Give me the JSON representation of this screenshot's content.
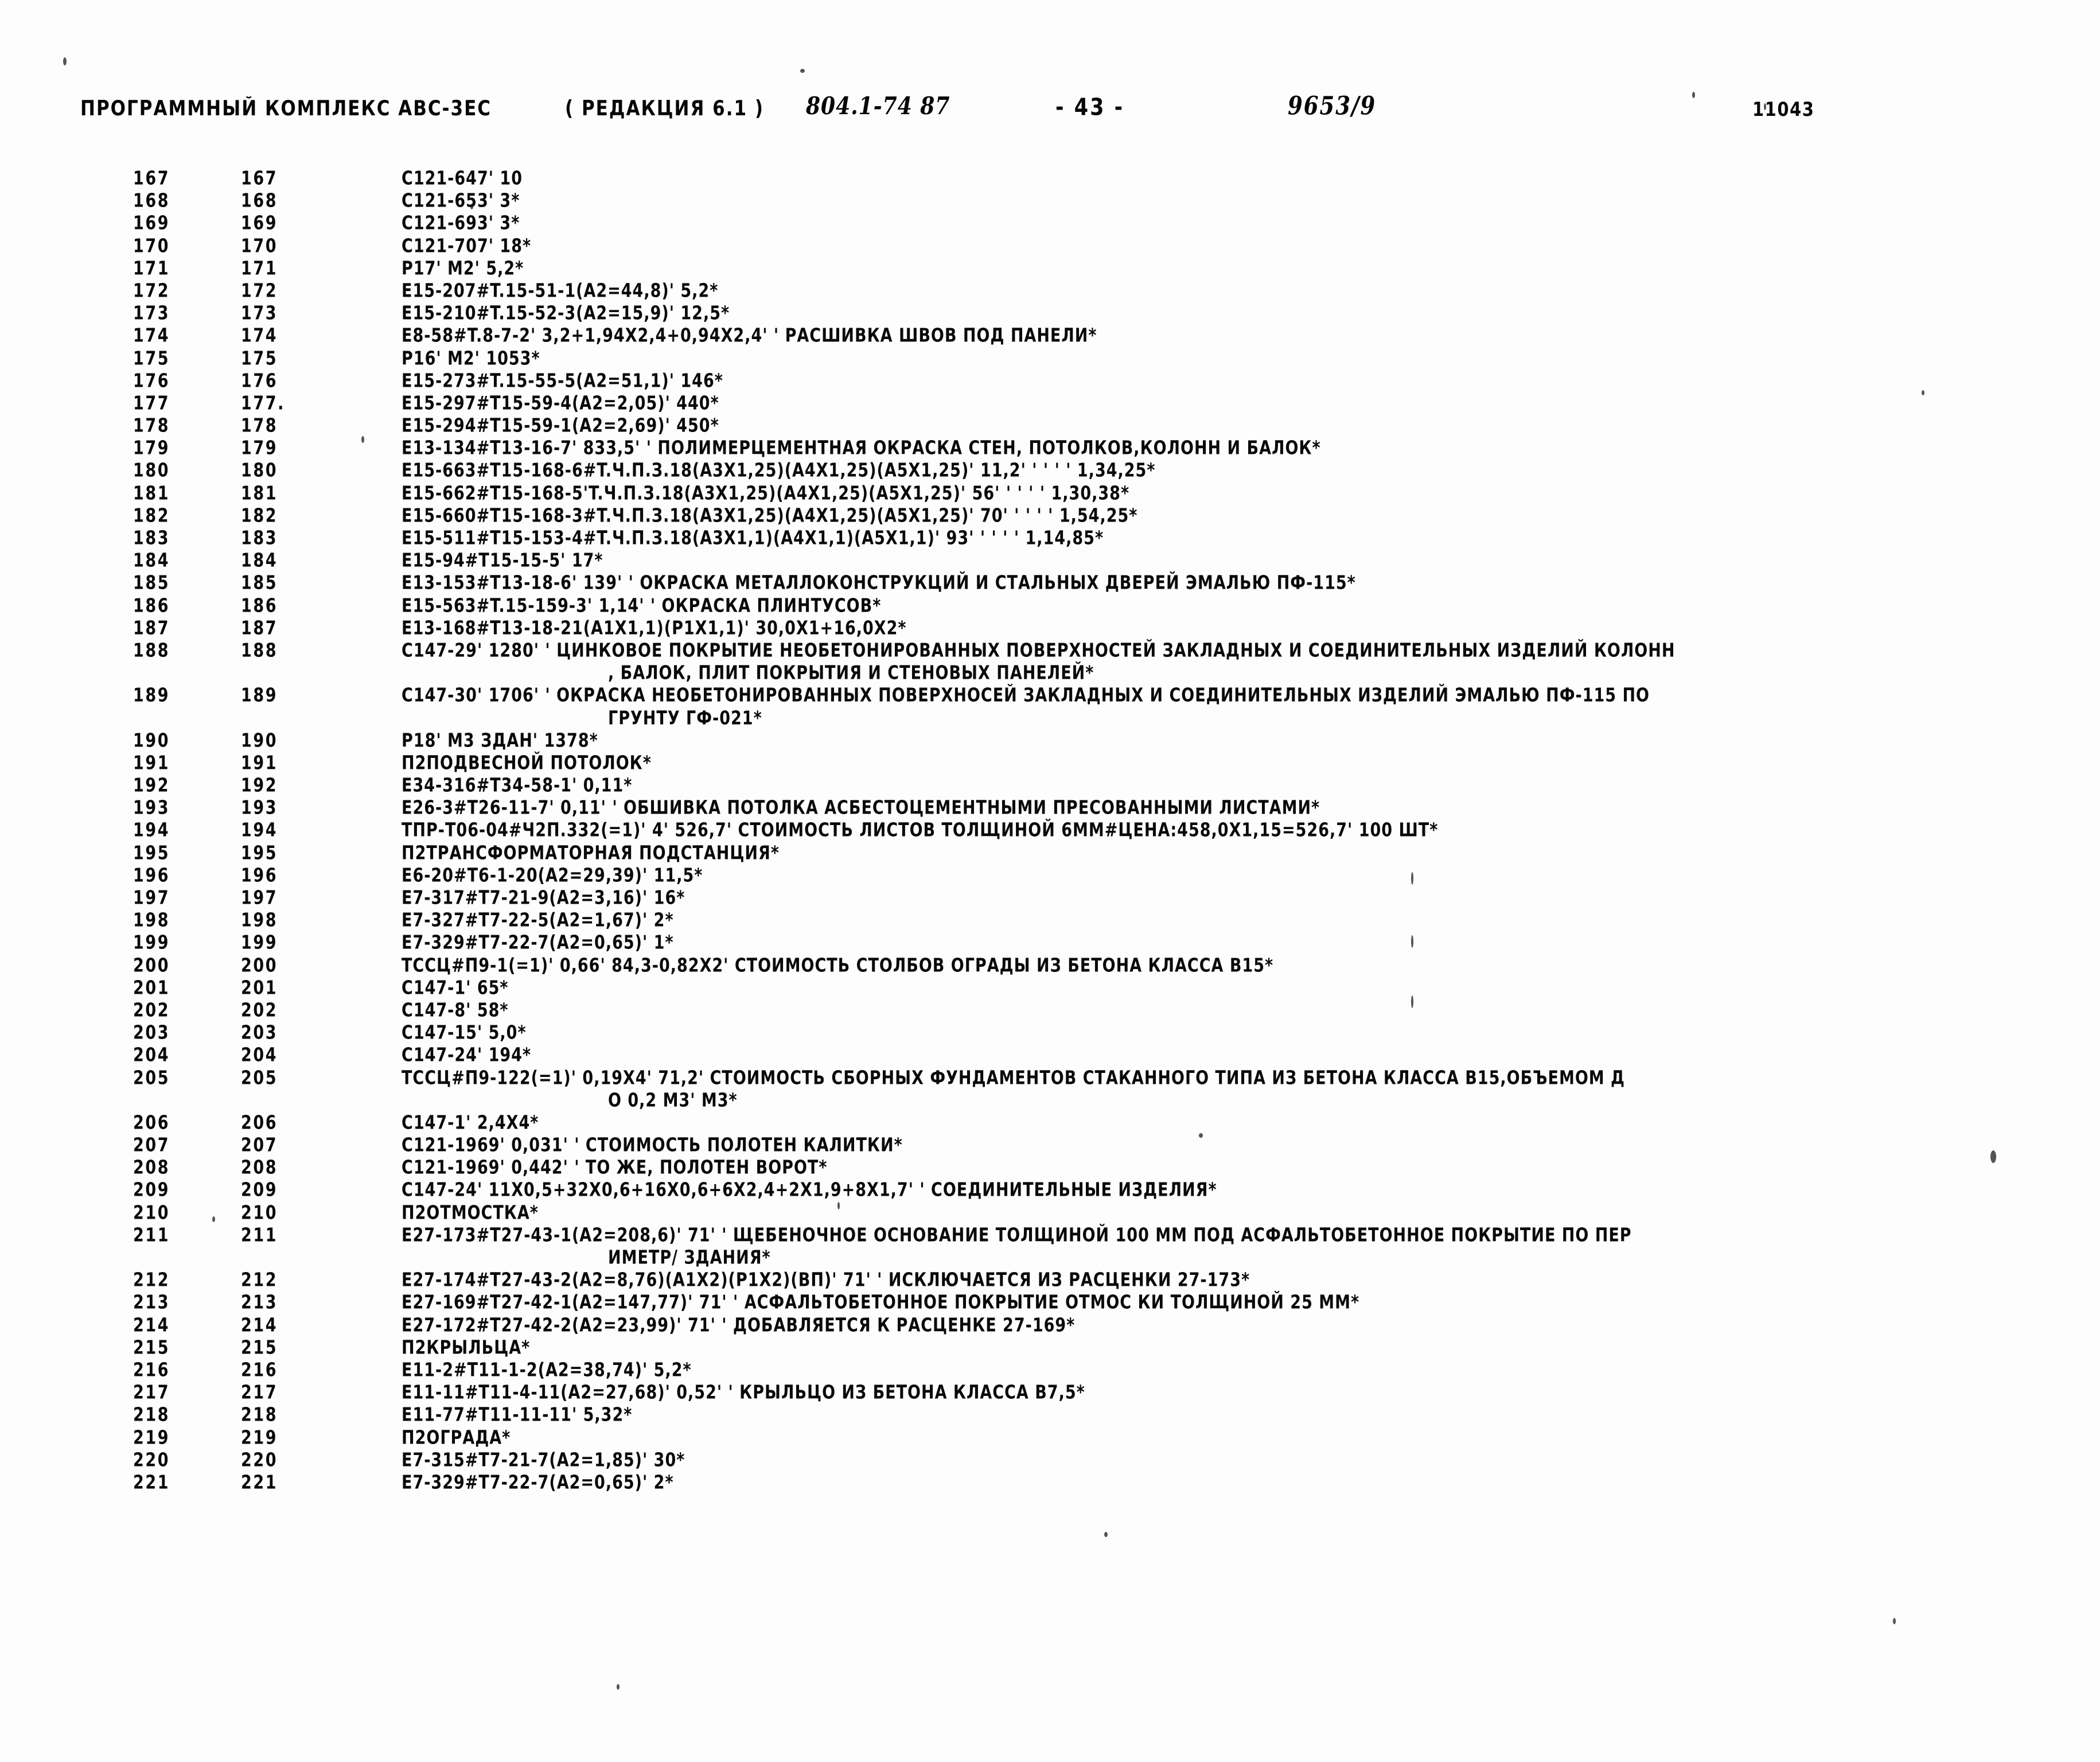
{
  "header": {
    "title": "ПРОГРАММНЫЙ КОМПЛЕКС АВС-3ЕС",
    "edition": "( РЕДАКЦИЯ 6.1 )",
    "code": "804.1-74 87",
    "page": "- 43 -",
    "order": "9653/9",
    "doc_number": "11043"
  },
  "listing": {
    "rows": [
      {
        "n1": "167",
        "n2": "167",
        "code": "C121-647' 10"
      },
      {
        "n1": "168",
        "n2": "168",
        "code": "C121-653' 3*"
      },
      {
        "n1": "169",
        "n2": "169",
        "code": "C121-693' 3*"
      },
      {
        "n1": "170",
        "n2": "170",
        "code": "C121-707' 18*"
      },
      {
        "n1": "171",
        "n2": "171",
        "code": "P17' M2' 5,2*"
      },
      {
        "n1": "172",
        "n2": "172",
        "code": "E15-207#T.15-51-1(A2=44,8)' 5,2*"
      },
      {
        "n1": "173",
        "n2": "173",
        "code": "E15-210#T.15-52-3(A2=15,9)' 12,5*"
      },
      {
        "n1": "174",
        "n2": "174",
        "code": "E8-58#T.8-7-2' 3,2+1,94X2,4+0,94X2,4' ' РАСШИВКА ШВОВ ПОД ПАНЕЛИ*"
      },
      {
        "n1": "175",
        "n2": "175",
        "code": "P16' M2' 1053*"
      },
      {
        "n1": "176",
        "n2": "176",
        "code": "E15-273#T.15-55-5(A2=51,1)' 146*"
      },
      {
        "n1": "177",
        "n2": "177.",
        "code": "E15-297#T15-59-4(A2=2,05)' 440*"
      },
      {
        "n1": "178",
        "n2": "178",
        "code": "E15-294#T15-59-1(A2=2,69)' 450*"
      },
      {
        "n1": "179",
        "n2": "179",
        "code": "E13-134#T13-16-7' 833,5' ' ПОЛИМЕРЦЕМЕНТНАЯ ОКРАСКА СТЕН, ПОТОЛКОВ,КОЛОНН И БАЛОК*"
      },
      {
        "n1": "180",
        "n2": "180",
        "code": "E15-663#T15-168-6#T.Ч.П.З.18(A3X1,25)(A4X1,25)(A5X1,25)' 11,2' ' ' ' ' 1,34,25*"
      },
      {
        "n1": "181",
        "n2": "181",
        "code": "E15-662#T15-168-5'T.Ч.П.З.18(A3X1,25)(A4X1,25)(A5X1,25)' 56' ' ' ' ' 1,30,38*"
      },
      {
        "n1": "182",
        "n2": "182",
        "code": "E15-660#T15-168-3#T.Ч.П.З.18(A3X1,25)(A4X1,25)(A5X1,25)' 70' ' ' ' ' 1,54,25*"
      },
      {
        "n1": "183",
        "n2": "183",
        "code": "E15-511#T15-153-4#T.Ч.П.З.18(A3X1,1)(A4X1,1)(A5X1,1)' 93' ' ' ' ' 1,14,85*"
      },
      {
        "n1": "184",
        "n2": "184",
        "code": "E15-94#T15-15-5' 17*"
      },
      {
        "n1": "185",
        "n2": "185",
        "code": "E13-153#T13-18-6' 139' ' ОКРАСКА МЕТАЛЛОКОНСТРУКЦИЙ И СТАЛЬНЫХ ДВЕРЕЙ ЭМАЛЬЮ ПФ-115*"
      },
      {
        "n1": "186",
        "n2": "186",
        "code": "E15-563#T.15-159-3' 1,14' ' ОКРАСКА ПЛИНТУСОВ*"
      },
      {
        "n1": "187",
        "n2": "187",
        "code": "E13-168#T13-18-21(A1X1,1)(P1X1,1)' 30,0X1+16,0X2*"
      },
      {
        "n1": "188",
        "n2": "188",
        "code": "C147-29' 1280' ' ЦИНКОВОЕ ПОКРЫТИЕ НЕОБЕТОНИРОВАННЫХ ПОВЕРХНОСТЕЙ ЗАКЛАДНЫХ И СОЕДИНИТЕЛЬНЫХ ИЗДЕЛИЙ КОЛОНН",
        "cont": ", БАЛОК, ПЛИТ ПОКРЫТИЯ И СТЕНОВЫХ ПАНЕЛЕЙ*"
      },
      {
        "n1": "189",
        "n2": "189",
        "code": "C147-30' 1706' ' ОКРАСКА НЕОБЕТОНИРОВАННЫХ ПОВЕРХНОСЕЙ ЗАКЛАДНЫХ И СОЕДИНИТЕЛЬНЫХ ИЗДЕЛИЙ ЭМАЛЬЮ ПФ-115 ПО",
        "cont": "ГРУНТУ ГФ-021*"
      },
      {
        "n1": "190",
        "n2": "190",
        "code": "P18' M3 ЗДАН' 1378*"
      },
      {
        "n1": "191",
        "n2": "191",
        "code": "П2ПОДВЕСНОЙ ПОТОЛОК*"
      },
      {
        "n1": "192",
        "n2": "192",
        "code": "E34-316#T34-58-1' 0,11*"
      },
      {
        "n1": "193",
        "n2": "193",
        "code": "E26-3#T26-11-7' 0,11' ' ОБШИВКА ПОТОЛКА АСБЕСТОЦЕМЕНТНЫМИ ПРЕСОВАННЫМИ ЛИСТАМИ*"
      },
      {
        "n1": "194",
        "n2": "194",
        "code": "ТПР-Т06-04#Ч2П.332(=1)' 4' 526,7' СТОИМОСТЬ ЛИСТОВ ТОЛЩИНОЙ 6ММ#ЦЕНА:458,0X1,15=526,7' 100 ШТ*"
      },
      {
        "n1": "195",
        "n2": "195",
        "code": "П2ТРАНСФОРМАТОРНАЯ ПОДСТАНЦИЯ*"
      },
      {
        "n1": "196",
        "n2": "196",
        "code": "E6-20#T6-1-20(A2=29,39)' 11,5*"
      },
      {
        "n1": "197",
        "n2": "197",
        "code": "E7-317#T7-21-9(A2=3,16)' 16*"
      },
      {
        "n1": "198",
        "n2": "198",
        "code": "E7-327#T7-22-5(A2=1,67)' 2*"
      },
      {
        "n1": "199",
        "n2": "199",
        "code": "E7-329#T7-22-7(A2=0,65)' 1*"
      },
      {
        "n1": "200",
        "n2": "200",
        "code": "ТССЦ#П9-1(=1)' 0,66' 84,3-0,82X2' СТОИМОСТЬ СТОЛБОВ ОГРАДЫ ИЗ БЕТОНА КЛАССА В15*"
      },
      {
        "n1": "201",
        "n2": "201",
        "code": "C147-1' 65*"
      },
      {
        "n1": "202",
        "n2": "202",
        "code": "C147-8' 58*"
      },
      {
        "n1": "203",
        "n2": "203",
        "code": "C147-15' 5,0*"
      },
      {
        "n1": "204",
        "n2": "204",
        "code": "C147-24' 194*"
      },
      {
        "n1": "205",
        "n2": "205",
        "code": "ТССЦ#П9-122(=1)' 0,19X4' 71,2' СТОИМОСТЬ СБОРНЫХ ФУНДАМЕНТОВ СТАКАННОГО ТИПА ИЗ БЕТОНА КЛАССА В15,ОБЪЕМОМ Д",
        "cont": "О 0,2 М3' М3*"
      },
      {
        "n1": "206",
        "n2": "206",
        "code": "C147-1' 2,4X4*"
      },
      {
        "n1": "207",
        "n2": "207",
        "code": "C121-1969' 0,031' ' СТОИМОСТЬ ПОЛОТЕН КАЛИТКИ*"
      },
      {
        "n1": "208",
        "n2": "208",
        "code": "C121-1969' 0,442' ' ТО ЖЕ, ПОЛОТЕН ВОРОТ*"
      },
      {
        "n1": "209",
        "n2": "209",
        "code": "C147-24' 11X0,5+32X0,6+16X0,6+6X2,4+2X1,9+8X1,7' ' СОЕДИНИТЕЛЬНЫЕ ИЗДЕЛИЯ*"
      },
      {
        "n1": "210",
        "n2": "210",
        "code": "П2ОТМОСТКА*"
      },
      {
        "n1": "211",
        "n2": "211",
        "code": "E27-173#T27-43-1(A2=208,6)' 71' ' ЩЕБЕНОЧНОЕ ОСНОВАНИЕ ТОЛЩИНОЙ 100 ММ ПОД АСФАЛЬТОБЕТОННОЕ ПОКРЫТИЕ ПО ПЕР",
        "cont": "ИМЕТР/ ЗДАНИЯ*"
      },
      {
        "n1": "212",
        "n2": "212",
        "code": "E27-174#T27-43-2(A2=8,76)(A1X2)(P1X2)(ВП)' 71' ' ИСКЛЮЧАЕТСЯ ИЗ РАСЦЕНКИ 27-173*"
      },
      {
        "n1": "213",
        "n2": "213",
        "code": "E27-169#T27-42-1(A2=147,77)' 71' ' АСФАЛЬТОБЕТОННОЕ ПОКРЫТИЕ ОТМОС КИ ТОЛЩИНОЙ 25 ММ*"
      },
      {
        "n1": "214",
        "n2": "214",
        "code": "E27-172#T27-42-2(A2=23,99)' 71' ' ДОБАВЛЯЕТСЯ К РАСЦЕНКЕ 27-169*"
      },
      {
        "n1": "215",
        "n2": "215",
        "code": "П2КРЫЛЬЦА*"
      },
      {
        "n1": "216",
        "n2": "216",
        "code": "E11-2#T11-1-2(A2=38,74)' 5,2*"
      },
      {
        "n1": "217",
        "n2": "217",
        "code": "E11-11#T11-4-11(A2=27,68)' 0,52' ' КРЫЛЬЦО ИЗ БЕТОНА КЛАССА В7,5*"
      },
      {
        "n1": "218",
        "n2": "218",
        "code": "E11-77#T11-11-11' 5,32*"
      },
      {
        "n1": "219",
        "n2": "219",
        "code": "П2ОГРАДА*"
      },
      {
        "n1": "220",
        "n2": "220",
        "code": "E7-315#T7-21-7(A2=1,85)' 30*"
      },
      {
        "n1": "221",
        "n2": "221",
        "code": "E7-329#T7-22-7(A2=0,65)' 2*"
      }
    ]
  }
}
